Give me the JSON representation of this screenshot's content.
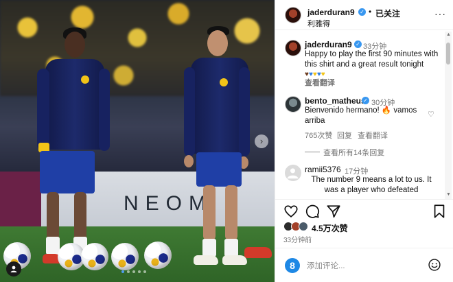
{
  "photo": {
    "board_text": "NEOM",
    "nav_arrow": "›",
    "tag_icon": "person-icon",
    "dots_count": 5
  },
  "header": {
    "username": "jaderduran9",
    "separator": "•",
    "follow_label": "已关注",
    "location": "利雅得",
    "more_label": "···"
  },
  "caption": {
    "username": "jaderduran9",
    "time": "33分钟",
    "text": "Happy to play the first 90 minutes with this shirt and a great result tonight"
  },
  "comments": [
    {
      "username": "bento_matheus",
      "time": "30分钟",
      "text": "Bienvenido hermano! 🔥 vamos arriba",
      "likes": "765次赞",
      "reply": "回复",
      "translate": "查看翻译",
      "view_replies": "查看所有14条回复"
    },
    {
      "username": "ramii5376",
      "time": "17分钟",
      "text": "The number 9 means a lot to us. It was a player who defeated"
    }
  ],
  "caption_translate": "查看翻译",
  "likes": {
    "count": "4.5万次赞",
    "time_ago": "33分钟前"
  },
  "add_comment": {
    "placeholder": "添加评论...",
    "avatar_letter": "8"
  },
  "colors": {
    "verified": "#3897f0",
    "link_blue": "#00376b",
    "kit_navy": "#1d2a6b",
    "kit_yellow": "#f2c418"
  }
}
